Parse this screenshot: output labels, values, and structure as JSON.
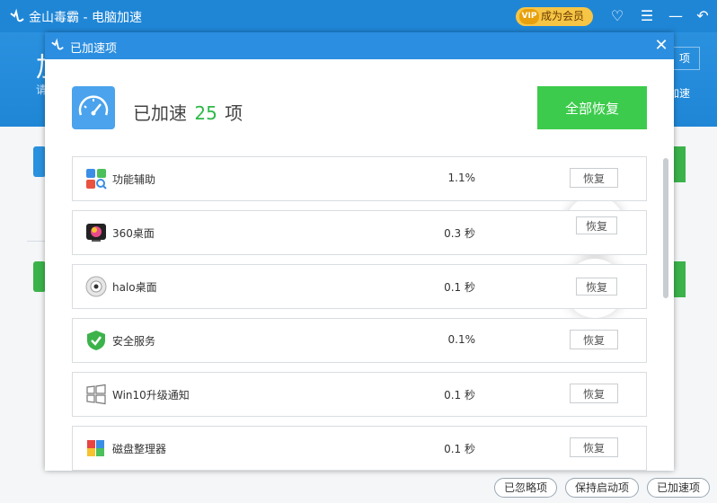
{
  "app": {
    "title": "金山毒霸 - 电脑加速",
    "vip_badge": "VIP",
    "vip_label": "成为会员",
    "header_big": "加",
    "header_sub": "请",
    "header_button": "项",
    "header_right_text": "加速"
  },
  "modal": {
    "title": "已加速项",
    "summary_prefix": "已加速",
    "count": "25",
    "summary_suffix": "项",
    "restore_all_label": "全部恢复",
    "items": [
      {
        "name": "功能辅助",
        "value": "1.1%",
        "button": "恢复",
        "icon": "feature-assist-icon"
      },
      {
        "name": "360桌面",
        "value": "0.3 秒",
        "button": "恢复",
        "icon": "desktop-360-icon"
      },
      {
        "name": "halo桌面",
        "value": "0.1 秒",
        "button": "恢复",
        "icon": "halo-desktop-icon"
      },
      {
        "name": "安全服务",
        "value": "0.1%",
        "button": "恢复",
        "icon": "security-shield-icon"
      },
      {
        "name": "Win10升级通知",
        "value": "0.1 秒",
        "button": "恢复",
        "icon": "windows-icon"
      },
      {
        "name": "磁盘整理器",
        "value": "0.1 秒",
        "button": "恢复",
        "icon": "disk-defrag-icon"
      }
    ]
  },
  "bottom": {
    "ignored_label": "已忽略项",
    "keep_startup_label": "保持启动项",
    "accelerated_label": "已加速项"
  },
  "colors": {
    "primary_blue": "#1f86d6",
    "accent_green": "#3ccb4c",
    "count_green": "#2fb84a"
  }
}
